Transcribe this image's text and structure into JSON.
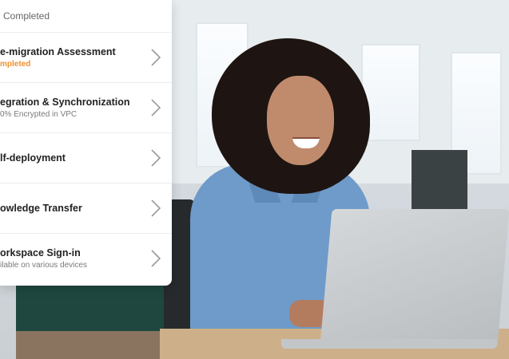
{
  "panel": {
    "top_status": "Completed",
    "items": [
      {
        "title": "e-migration Assessment",
        "subtitle": "mpleted"
      },
      {
        "title": "egration & Synchronization",
        "subtitle": "0% Encrypted in VPC"
      },
      {
        "title": "lf-deployment",
        "subtitle": ""
      },
      {
        "title": "owledge Transfer",
        "subtitle": ""
      },
      {
        "title": "orkspace Sign-in",
        "subtitle": "ilable on various devices"
      }
    ],
    "chevron_icon": "chevron-right-icon",
    "accent_color": "#f0912e"
  },
  "photo": {
    "icon": "photo-woman-laptop"
  }
}
